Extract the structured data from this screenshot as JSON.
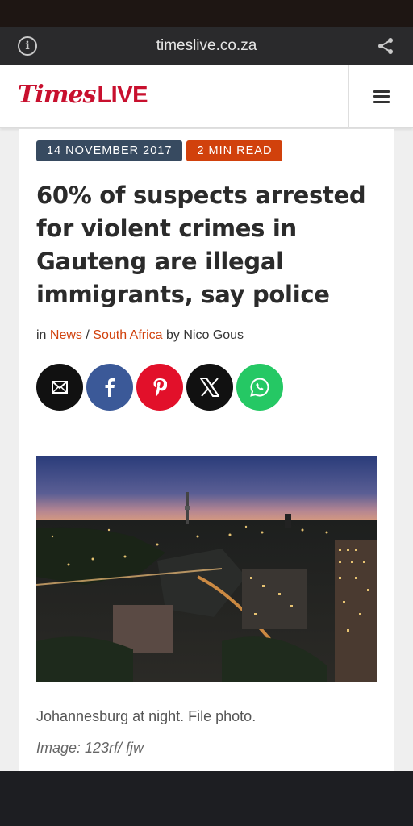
{
  "browser": {
    "url": "timeslive.co.za",
    "info_icon": "info-icon",
    "share_icon": "share-icon"
  },
  "header": {
    "logo_part1": "Times",
    "logo_part2": "LIVE",
    "logo_color": "#c8102e",
    "menu_icon": "hamburger-menu-icon"
  },
  "article": {
    "date": "14 NOVEMBER 2017",
    "read_time": "2 MIN READ",
    "headline": "60% of suspects arrested for violent crimes in Gauteng are illegal immigrants, say police",
    "byline_in": "in",
    "category_1": "News",
    "separator": "/",
    "category_2": "South Africa",
    "byline_by": "by Nico Gous",
    "share_buttons": [
      "email-icon",
      "facebook-icon",
      "pinterest-icon",
      "x-icon",
      "whatsapp-icon"
    ],
    "caption": "Johannesburg at night. File photo.",
    "credit": "Image: 123rf/ fjw"
  },
  "colors": {
    "accent": "#d1410c",
    "date_badge": "#374a60",
    "facebook": "#3b5998",
    "pinterest": "#e2102a",
    "whatsapp": "#25c864"
  }
}
